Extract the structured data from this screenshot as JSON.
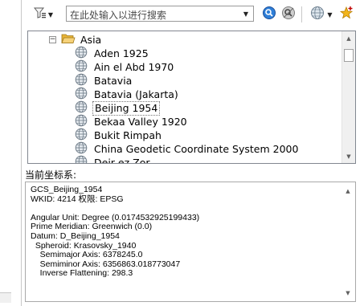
{
  "toolbar": {
    "search": {
      "placeholder": "在此处输入以进行搜索",
      "value": ""
    }
  },
  "tree": {
    "root": {
      "label": "Asia",
      "expanded": true
    },
    "items": [
      {
        "label": "Aden 1925"
      },
      {
        "label": "Ain el Abd 1970"
      },
      {
        "label": "Batavia"
      },
      {
        "label": "Batavia (Jakarta)"
      },
      {
        "label": "Beijing 1954",
        "selected": true
      },
      {
        "label": "Bekaa Valley 1920"
      },
      {
        "label": "Bukit Rimpah"
      },
      {
        "label": "China Geodetic Coordinate System 2000"
      },
      {
        "label": "Deir ez Zor"
      }
    ]
  },
  "current": {
    "label": "当前坐标系:",
    "lines": [
      "GCS_Beijing_1954",
      "WKID: 4214 权限: EPSG",
      "",
      "Angular Unit: Degree (0.0174532925199433)",
      "Prime Meridian: Greenwich (0.0)",
      "Datum: D_Beijing_1954",
      "  Spheroid: Krasovsky_1940",
      "    Semimajor Axis: 6378245.0",
      "    Semiminor Axis: 6356863.018773047",
      "    Inverse Flattening: 298.3"
    ]
  },
  "colors": {
    "accent_blue": "#1e6bd6",
    "folder": "#e8b437",
    "star": "#f2b51c"
  }
}
